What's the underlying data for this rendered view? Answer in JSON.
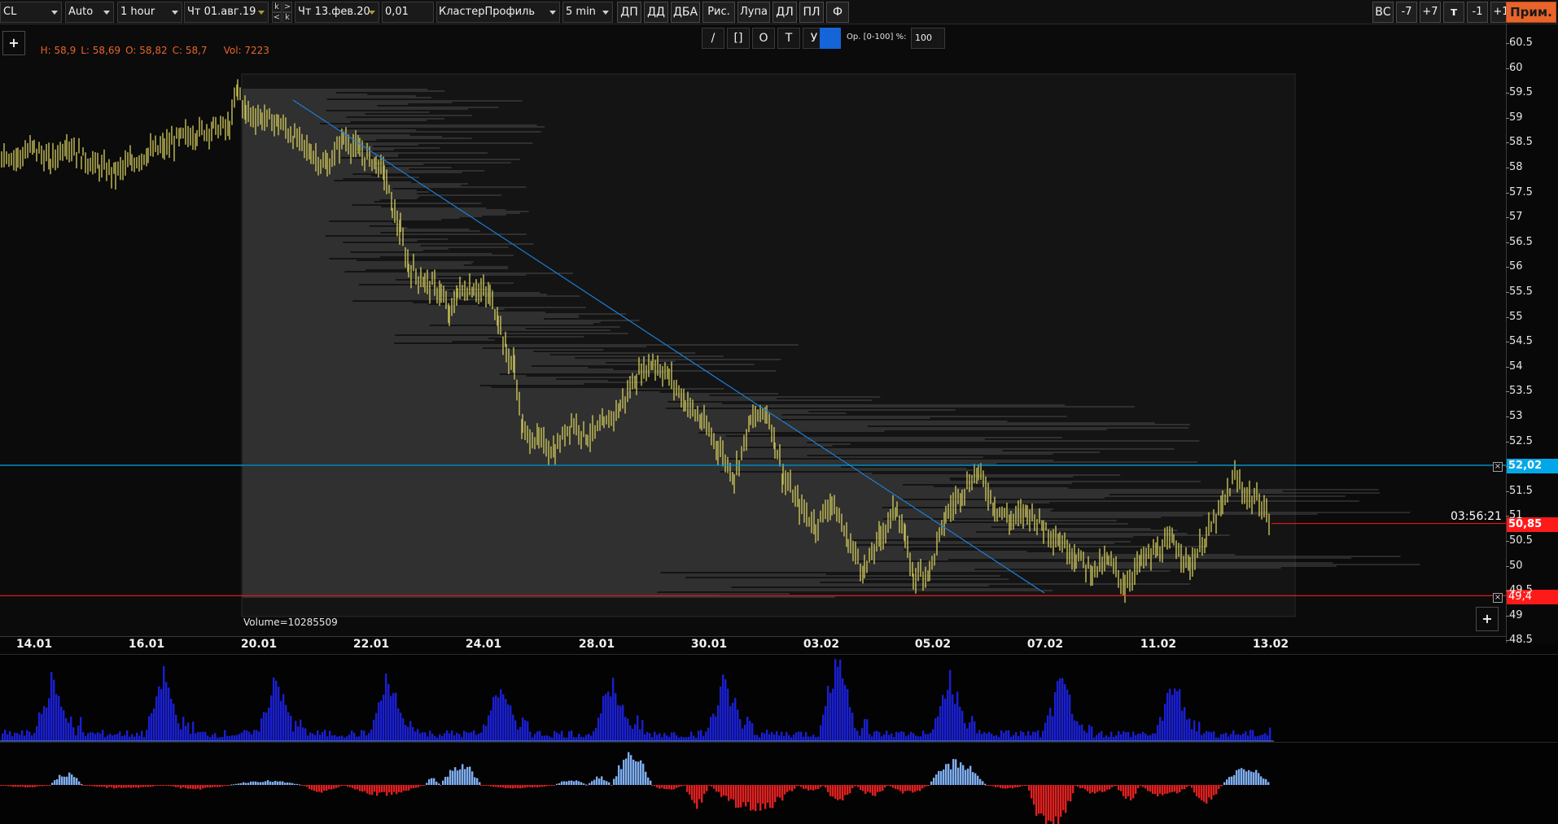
{
  "toolbar": {
    "symbol": "CL",
    "scale_mode": "Auto",
    "timeframe": "1 hour",
    "date_from": "Чт 01.авг.19",
    "date_to": "Чт 13.фев.20",
    "tick_size": "0,01",
    "indicator": "КластерПрофиль",
    "cluster_period": "5 min",
    "nav_k_top": "k",
    "nav_k_bottom": "k",
    "nav_right_arrow": ">",
    "nav_left_arrow": "<",
    "buttons": [
      "ДП",
      "ДД",
      "ДБА",
      "Рис.",
      "Лупа",
      "ДЛ",
      "ПЛ",
      "Ф"
    ],
    "right_buttons": [
      "ВС",
      "-7",
      "+7",
      "т",
      "-1",
      "+1"
    ],
    "apply_button": "Прим."
  },
  "ohlc": {
    "high": "H: 58,9",
    "low": "L: 58,69",
    "open": "O: 58,82",
    "close": "C: 58,7",
    "volume": "Vol: 7223"
  },
  "add_button_label": "+",
  "drawing_tools": [
    "/",
    "[]",
    "O",
    "T",
    "У"
  ],
  "drawing_color": "#1565d8",
  "opacity": {
    "label": "Op. [0-100] %:",
    "value": "100"
  },
  "volume_profile_label": "Volume=10285509",
  "timer": "03:56:21",
  "price_axis": {
    "ticks": [
      "60.5",
      "60",
      "59.5",
      "59",
      "58.5",
      "58",
      "57.5",
      "57",
      "56.5",
      "56",
      "55.5",
      "55",
      "54.5",
      "54",
      "53.5",
      "53",
      "52.5",
      "52",
      "51.5",
      "51",
      "50.5",
      "50",
      "49.5",
      "49",
      "48.5"
    ],
    "current_price": "50,85",
    "current_price_color": "#ff1a1a",
    "upper_line_price": "52,02",
    "upper_line_color": "#00a8e8",
    "lower_line_price": "49,4",
    "lower_line_color": "#ff1a1a"
  },
  "date_axis": {
    "ticks": [
      "14.01",
      "16.01",
      "20.01",
      "22.01",
      "24.01",
      "28.01",
      "30.01",
      "03.02",
      "05.02",
      "07.02",
      "11.02",
      "13.02"
    ]
  },
  "colors": {
    "bar_color": "#c9c25a",
    "profile_color": "#7a7a7a",
    "trend_line": "#1e7fd6",
    "volume_bar": "#1a1fd4",
    "delta_positive": "#7faef0",
    "delta_negative": "#e02020"
  }
}
